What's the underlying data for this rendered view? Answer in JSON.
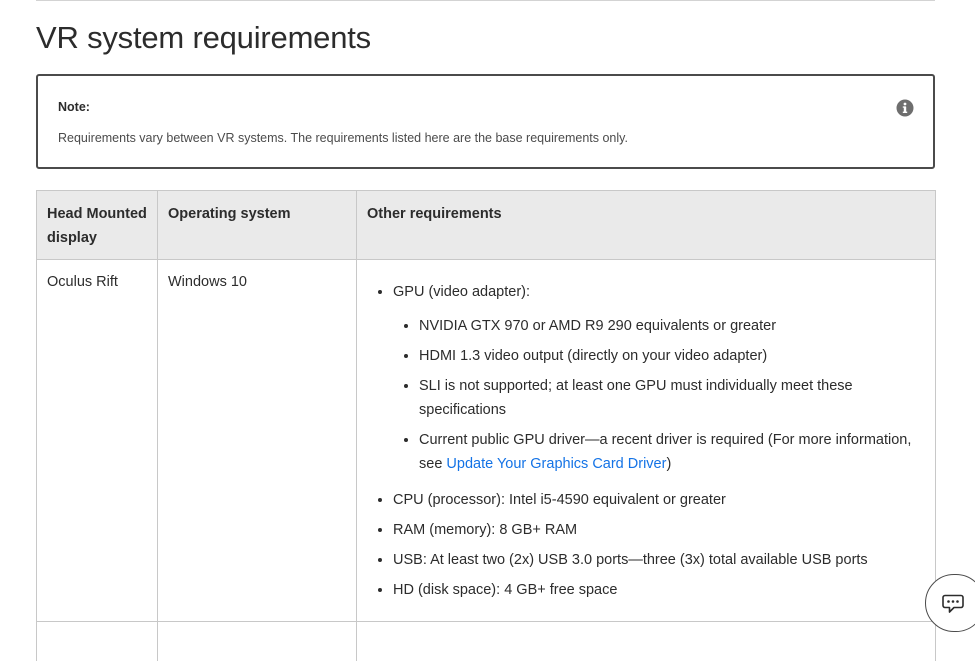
{
  "page": {
    "title": "VR system requirements"
  },
  "note": {
    "title": "Note:",
    "text": "Requirements vary between VR systems. The requirements listed here are the base requirements only.",
    "icon": "info-icon"
  },
  "table": {
    "headers": [
      "Head Mounted display",
      "Operating system",
      "Other requirements"
    ],
    "rows": [
      {
        "device": "Oculus Rift",
        "os": "Windows 10",
        "gpu_label": "GPU (video adapter):",
        "gpu_items": [
          "NVIDIA GTX 970 or AMD R9 290 equivalents or greater",
          "HDMI 1.3 video output (directly on your video adapter)",
          "SLI is not supported; at least one GPU must individually meet these specifications"
        ],
        "driver_text_before": "Current public GPU driver—a recent driver is required (For more information, see ",
        "driver_link": "Update Your Graphics Card Driver",
        "driver_text_after": ")",
        "other_items": [
          "CPU (processor): Intel i5-4590 equivalent or greater",
          "RAM (memory): 8 GB+ RAM",
          "USB: At least two (2x) USB 3.0 ports—three (3x) total available USB ports",
          "HD (disk space): 4 GB+ free space"
        ]
      }
    ]
  },
  "chat": {
    "icon": "chat-bubble-icon"
  }
}
